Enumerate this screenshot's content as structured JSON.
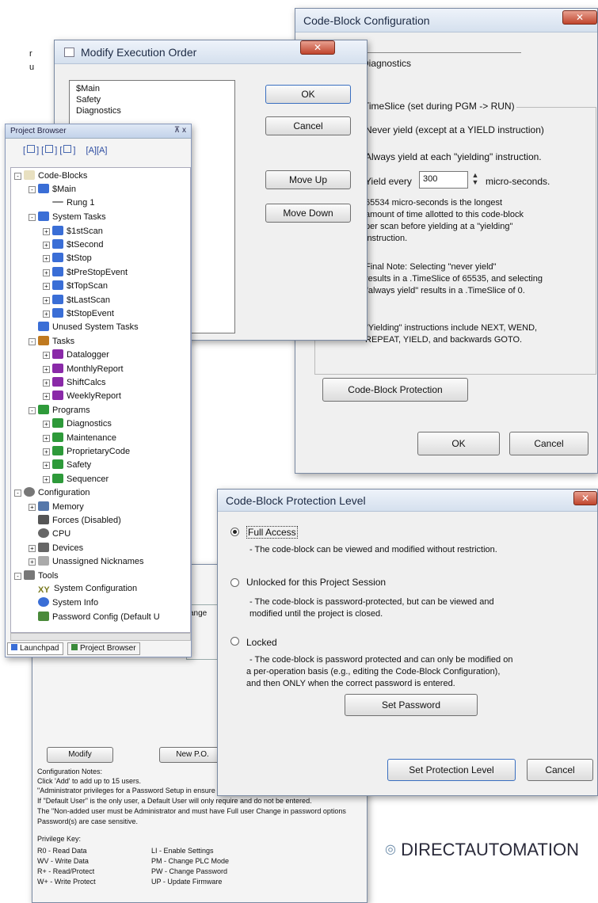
{
  "corner_text": [
    "r",
    "u"
  ],
  "code_block_config": {
    "title": "Code-Block Configuration",
    "name_value": "Diagnostics",
    "group_title": "TimeSlice (set during PGM -> RUN)",
    "never_yield": "Never yield (except at a YIELD instruction)",
    "always_yield": "Always yield at each \"yielding\" instruction.",
    "yield_every": "Yield every",
    "yield_value": "300",
    "micro_seconds": "micro-seconds.",
    "info1": [
      "65534 micro-seconds is the longest",
      "amount of time allotted to this code-block",
      "per scan before yielding at a \"yielding\"",
      "instruction."
    ],
    "info2": [
      "Final Note: Selecting \"never yield\"",
      "results in a .TimeSlice of 65535, and selecting",
      "\"always yield\" results in a .TimeSlice of 0."
    ],
    "info3": [
      "\"Yielding\" instructions include NEXT, WEND,",
      "REPEAT, YIELD, and backwards GOTO."
    ],
    "protection_button": "Code-Block Protection",
    "ok": "OK",
    "cancel": "Cancel"
  },
  "modify_order": {
    "title": "Modify Execution Order",
    "items": [
      "$Main",
      "Safety",
      "Diagnostics"
    ],
    "ok": "OK",
    "cancel": "Cancel",
    "move_up": "Move Up",
    "move_down": "Move Down"
  },
  "project_browser": {
    "title": "Project Browser",
    "pin": "⊼ x",
    "toolbar_labels": [
      "[",
      "] [",
      "] [",
      "]",
      "[A]",
      "[A]"
    ],
    "tree": [
      {
        "label": "Code-Blocks",
        "indent": 0,
        "pm": "-",
        "icon": "folder",
        "color": "#e8e0c0"
      },
      {
        "label": "$Main",
        "indent": 1,
        "pm": "-",
        "icon": "block",
        "color": "#3a6ed6"
      },
      {
        "label": "Rung 1",
        "indent": 2,
        "pm": "",
        "icon": "rung",
        "color": "#888888"
      },
      {
        "label": "System Tasks",
        "indent": 1,
        "pm": "-",
        "icon": "folder",
        "color": "#3a6ed6"
      },
      {
        "label": "$1stScan",
        "indent": 2,
        "pm": "+",
        "icon": "block",
        "color": "#3a6ed6"
      },
      {
        "label": "$tSecond",
        "indent": 2,
        "pm": "+",
        "icon": "block",
        "color": "#3a6ed6"
      },
      {
        "label": "$tStop",
        "indent": 2,
        "pm": "+",
        "icon": "block",
        "color": "#3a6ed6"
      },
      {
        "label": "$tPreStopEvent",
        "indent": 2,
        "pm": "+",
        "icon": "block",
        "color": "#3a6ed6"
      },
      {
        "label": "$tTopScan",
        "indent": 2,
        "pm": "+",
        "icon": "block",
        "color": "#3a6ed6"
      },
      {
        "label": "$tLastScan",
        "indent": 2,
        "pm": "+",
        "icon": "block",
        "color": "#3a6ed6"
      },
      {
        "label": "$tStopEvent",
        "indent": 2,
        "pm": "+",
        "icon": "block",
        "color": "#3a6ed6"
      },
      {
        "label": "Unused System Tasks",
        "indent": 1,
        "pm": "",
        "icon": "folder",
        "color": "#3a6ed6"
      },
      {
        "label": "Tasks",
        "indent": 1,
        "pm": "-",
        "icon": "folder",
        "color": "#c07a20"
      },
      {
        "label": "Datalogger",
        "indent": 2,
        "pm": "+",
        "icon": "block",
        "color": "#8a2aa8"
      },
      {
        "label": "MonthlyReport",
        "indent": 2,
        "pm": "+",
        "icon": "block",
        "color": "#8a2aa8"
      },
      {
        "label": "ShiftCalcs",
        "indent": 2,
        "pm": "+",
        "icon": "block",
        "color": "#8a2aa8"
      },
      {
        "label": "WeeklyReport",
        "indent": 2,
        "pm": "+",
        "icon": "block",
        "color": "#8a2aa8"
      },
      {
        "label": "Programs",
        "indent": 1,
        "pm": "-",
        "icon": "folder",
        "color": "#2e9a3a"
      },
      {
        "label": "Diagnostics",
        "indent": 2,
        "pm": "+",
        "icon": "block",
        "color": "#2e9a3a"
      },
      {
        "label": "Maintenance",
        "indent": 2,
        "pm": "+",
        "icon": "block",
        "color": "#2e9a3a"
      },
      {
        "label": "ProprietaryCode",
        "indent": 2,
        "pm": "+",
        "icon": "block",
        "color": "#2e9a3a"
      },
      {
        "label": "Safety",
        "indent": 2,
        "pm": "+",
        "icon": "block",
        "color": "#2e9a3a"
      },
      {
        "label": "Sequencer",
        "indent": 2,
        "pm": "+",
        "icon": "block",
        "color": "#2e9a3a"
      },
      {
        "label": "Configuration",
        "indent": 0,
        "pm": "-",
        "icon": "gear",
        "color": "#777777"
      },
      {
        "label": "Memory",
        "indent": 1,
        "pm": "+",
        "icon": "mem",
        "color": "#5577aa"
      },
      {
        "label": "Forces (Disabled)",
        "indent": 1,
        "pm": "",
        "icon": "force",
        "color": "#555555"
      },
      {
        "label": "CPU",
        "indent": 1,
        "pm": "",
        "icon": "cpu",
        "color": "#666666"
      },
      {
        "label": "Devices",
        "indent": 1,
        "pm": "+",
        "icon": "dev",
        "color": "#666666"
      },
      {
        "label": "Unassigned Nicknames",
        "indent": 1,
        "pm": "+",
        "icon": "list",
        "color": "#aaaaaa"
      },
      {
        "label": "Tools",
        "indent": 0,
        "pm": "-",
        "icon": "tools",
        "color": "#777777"
      },
      {
        "label": "System Configuration",
        "indent": 1,
        "pm": "",
        "icon": "xy",
        "color": "#7a7a20"
      },
      {
        "label": "System Info",
        "indent": 1,
        "pm": "",
        "icon": "info",
        "color": "#3a6ed6"
      },
      {
        "label": "Password Config (Default U",
        "indent": 1,
        "pm": "",
        "icon": "key",
        "color": "#4a8a3a"
      }
    ],
    "xy_glyph": "XY",
    "tabs": [
      "Launchpad",
      "Project Browser"
    ]
  },
  "code_block_protection": {
    "title": "Code-Block Protection Level",
    "full_access": "Full Access",
    "full_access_desc": "- The code-block can be viewed and modified without restriction.",
    "unlocked": "Unlocked for this Project Session",
    "unlocked_desc": [
      "- The code-block is password-protected, but can be viewed and",
      "modified until the project is closed."
    ],
    "locked": "Locked",
    "locked_desc": [
      "- The code-block is password protected and can only be modified on",
      "a per-operation basis (e.g., editing the Code-Block Configuration),",
      "and then ONLY when the correct password is entered."
    ],
    "set_password": "Set Password",
    "set_level": "Set Protection Level",
    "cancel": "Cancel"
  },
  "bg_dialog": {
    "fragment": "ange",
    "btn1": "Modify",
    "btn2": "New P.O.",
    "lines": [
      "Configuration Notes:",
      "Click 'Add' to add up to 15 users.",
      "\"Administrator privileges for a Password Setup in ensure the",
      "If \"Default User\" is the only user, a Default User will only require and do not be entered.",
      "The \"Non-added user must be Administrator and must have Full user Change in password options",
      "Password(s) are case sensitive."
    ],
    "priv_title": "Privilege Key:",
    "priv_left": [
      "R0 - Read Data",
      "WV - Write Data",
      "R+ - Read/Protect",
      "W+ - Write Protect"
    ],
    "priv_right": [
      "LI - Enable Settings",
      "PM - Change PLC Mode",
      "PW - Change Password",
      "UP - Update Firmware"
    ]
  },
  "brand": {
    "bullet": "◎",
    "text": "DIRECTAUTOMATION"
  }
}
